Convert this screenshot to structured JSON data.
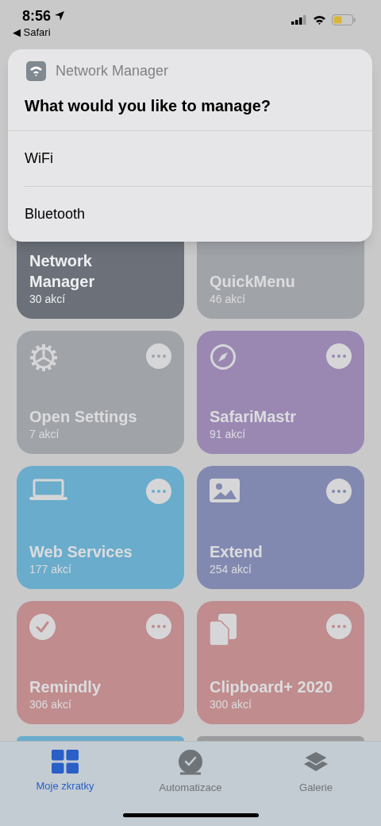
{
  "status_bar": {
    "time": "8:56",
    "back_link": "◀ Safari"
  },
  "dialog": {
    "app_name": "Network Manager",
    "question": "What would you like to manage?",
    "options": [
      {
        "label": "WiFi"
      },
      {
        "label": "Bluetooth"
      }
    ]
  },
  "shortcuts": [
    {
      "kind": "covered",
      "name": "Network Manager",
      "count": "30 akcí",
      "color": "#6b7079",
      "running": true
    },
    {
      "kind": "covered",
      "name": "QuickMenu",
      "count": "46 akcí",
      "color": "#a0a3a8",
      "running": false
    },
    {
      "kind": "full",
      "name": "Open Settings",
      "count": "7 akcí",
      "color": "#a0a3a8",
      "running": false
    },
    {
      "kind": "full",
      "name": "SafariMastr",
      "count": "91 akcí",
      "color": "#9a88b3",
      "running": false
    },
    {
      "kind": "full",
      "name": "Web Services",
      "count": "177 akcí",
      "color": "#6aaccb",
      "running": false
    },
    {
      "kind": "full",
      "name": "Extend",
      "count": "254 akcí",
      "color": "#8289b0",
      "running": false
    },
    {
      "kind": "full",
      "name": "Remindly",
      "count": "306 akcí",
      "color": "#c08c8e",
      "running": false
    },
    {
      "kind": "full",
      "name": "Clipboard+ 2020",
      "count": "300 akcí",
      "color": "#c08c8e",
      "running": false
    },
    {
      "kind": "stub",
      "color": "#6aaccb"
    },
    {
      "kind": "stub",
      "color": "#9c9c9e"
    }
  ],
  "tabs": [
    {
      "label": "Moje zkratky",
      "selected": true
    },
    {
      "label": "Automatizace",
      "selected": false
    },
    {
      "label": "Galerie",
      "selected": false
    }
  ]
}
